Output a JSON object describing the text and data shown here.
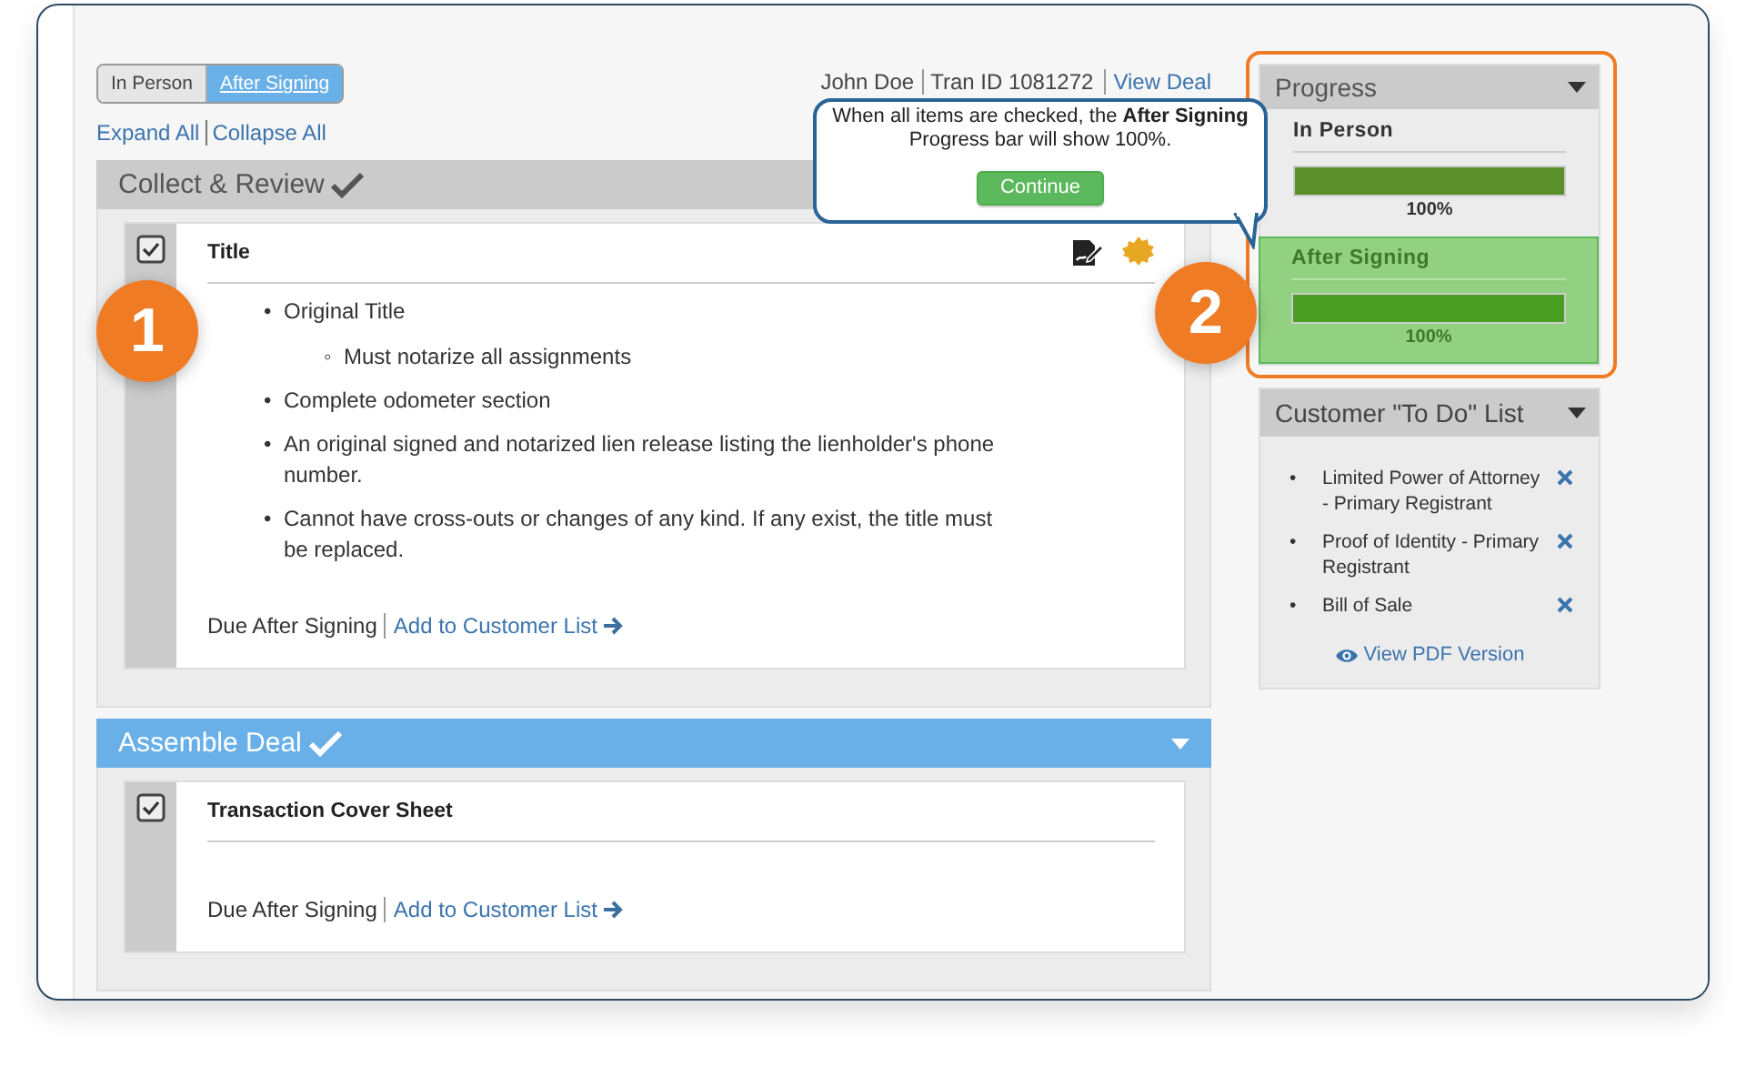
{
  "view_toggle": [
    {
      "label": "In Person",
      "selected": false
    },
    {
      "label": "After Signing",
      "selected": true
    }
  ],
  "expand_links": [
    "Expand All",
    "Collapse All"
  ],
  "deal_header": {
    "customer": "John Doe",
    "tran_id": "Tran ID 1081272",
    "link": "View Deal"
  },
  "sections": [
    {
      "title": "Collect & Review",
      "complete": true,
      "selected": false,
      "items": [
        {
          "title": "Title",
          "checked": true,
          "actions": true,
          "bullets": [
            {
              "marker": "•",
              "text": "Original Title",
              "children": [
                {
                  "marker": "◦",
                  "text": "Must notarize all assignments"
                }
              ]
            },
            {
              "marker": "•",
              "text": "Complete odometer section"
            },
            {
              "marker": "•",
              "text": "An original signed and notarized lien release listing the lienholder's phone number."
            },
            {
              "marker": "•",
              "text": "Cannot have cross-outs or changes of any kind. If any exist, the title must be replaced."
            }
          ],
          "due": "Due After Signing",
          "link": "Add to Customer List"
        }
      ]
    },
    {
      "title": "Assemble Deal",
      "complete": true,
      "selected": true,
      "items": [
        {
          "title": "Transaction Cover Sheet",
          "checked": true,
          "actions": false,
          "due": "Due After Signing",
          "link": "Add to Customer List"
        }
      ]
    }
  ],
  "tooltip": {
    "text": "When all items are checked, the **After Signing** Progress bar will show 100%.",
    "button": "Continue"
  },
  "progress": {
    "title": "Progress",
    "groups": [
      {
        "label": "In Person",
        "selected": false,
        "level": 1,
        "reading": "100%"
      },
      {
        "label": "After Signing",
        "selected": true,
        "level": 1,
        "reading": "100%"
      }
    ]
  },
  "todo": {
    "title": "Customer \"To Do\" List",
    "items": [
      {
        "marker": "•",
        "text": "Limited Power of Attorney - Primary Registrant"
      },
      {
        "marker": "•",
        "text": "Proof of Identity - Primary Registrant"
      },
      {
        "marker": "•",
        "text": "Bill of Sale"
      }
    ],
    "link": "View PDF Version"
  },
  "callouts": [
    {
      "number": "1"
    },
    {
      "number": "2"
    }
  ]
}
